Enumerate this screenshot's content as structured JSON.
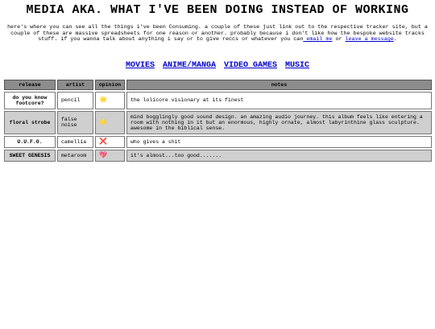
{
  "title": "MEDIA AKA. WHAT I'VE BEEN DOING INSTEAD OF WORKING",
  "intro": {
    "text": "here's where you can see all the things i've been Consuming. a couple of these just link out to the respective tracker site, but a couple of these are massive spreadsheets for one reason or another. probably because i don't like how the bespoke website tracks stuff. if you wanna talk about anything i say or to give reccs or whatever you can",
    "email_link": " email me",
    "or": " or ",
    "message_link": "leave a message",
    "end": "."
  },
  "nav": [
    "MOVIES",
    "ANIME/MANGA",
    "VIDEO GAMES",
    "MUSIC"
  ],
  "table": {
    "headers": [
      "release",
      "artist",
      "opinion",
      "notes"
    ],
    "rows": [
      {
        "release": "do you know footcore?",
        "artist": "pencil",
        "opinion": "🌟",
        "notes": "the lolicore visionary at its finest",
        "shade": "white"
      },
      {
        "release": "floral strobe",
        "artist": "false noise",
        "opinion": "🌟",
        "notes": "mind bogglingly good sound design. an amazing audio journey. this album feels like entering a room with nothing in it but an enormous, highly ornate, almost labyrinthine glass sculpture. awesome in the biblical sense.",
        "shade": "grey"
      },
      {
        "release": "U.U.F.O.",
        "artist": "camellia",
        "opinion": "❌",
        "notes": "who gives a shit",
        "shade": "white"
      },
      {
        "release": "SWEET GENESIS",
        "artist": "metaroom",
        "opinion": "💖",
        "notes": "it's almost...too good.......",
        "shade": "grey"
      }
    ]
  }
}
